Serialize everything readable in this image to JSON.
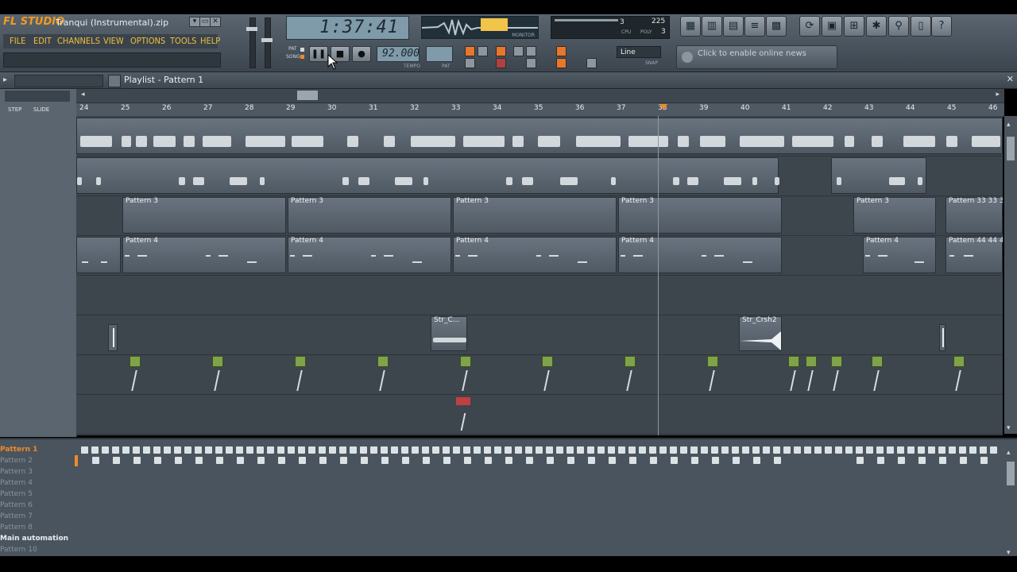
{
  "app": {
    "logo": "FL STUDIO",
    "file_title": "Tranqui (Instrumental).zip"
  },
  "window_controls": [
    "▾",
    "▭",
    "✕"
  ],
  "menu": [
    "FILE",
    "EDIT",
    "CHANNELS",
    "VIEW",
    "OPTIONS",
    "TOOLS",
    "HELP"
  ],
  "transport": {
    "time": "1:37:41",
    "tempo": "92.000",
    "tempo_label": "TEMPO",
    "pat_label": "PAT",
    "pat_label_top": "PAT",
    "song_label": "SONG",
    "monitor_label": "MONITOR",
    "cpu_label": "CPU",
    "poly_label": "POLY",
    "cpu_value": "225",
    "poly_value": "3",
    "meter_value": "3"
  },
  "snap": {
    "value": "Line",
    "label": "SNAP"
  },
  "online_news": "Click to enable online news",
  "playlist": {
    "title": "Playlist - Pattern 1",
    "step_label": "STEP",
    "slide_label": "SLIDE",
    "ruler": [
      "24",
      "25",
      "26",
      "27",
      "28",
      "29",
      "30",
      "31",
      "32",
      "33",
      "34",
      "35",
      "36",
      "37",
      "38",
      "39",
      "40",
      "41",
      "42",
      "43",
      "44",
      "45",
      "46"
    ],
    "track3_clips": [
      "Pattern 3",
      "Pattern 3",
      "Pattern 3",
      "Pattern 3",
      "Pattern 3",
      "Pattern 33 33 3"
    ],
    "track4_clips": [
      "Pattern 4",
      "Pattern 4",
      "Pattern 4",
      "Pattern 4",
      "Pattern 4",
      "Pattern 44 44 4"
    ],
    "clip_str_c": "Str_C...",
    "clip_str_crsh": "Str_Crsh2"
  },
  "patterns": [
    "Pattern 1",
    "Pattern 2",
    "Pattern 3",
    "Pattern 4",
    "Pattern 5",
    "Pattern 6",
    "Pattern 7",
    "Pattern 8",
    "Main automation",
    "Pattern 10"
  ],
  "colors": {
    "menu_text": "#f2c03a",
    "logo": "#f39a1e",
    "selected_pattern": "#f08a2a"
  }
}
